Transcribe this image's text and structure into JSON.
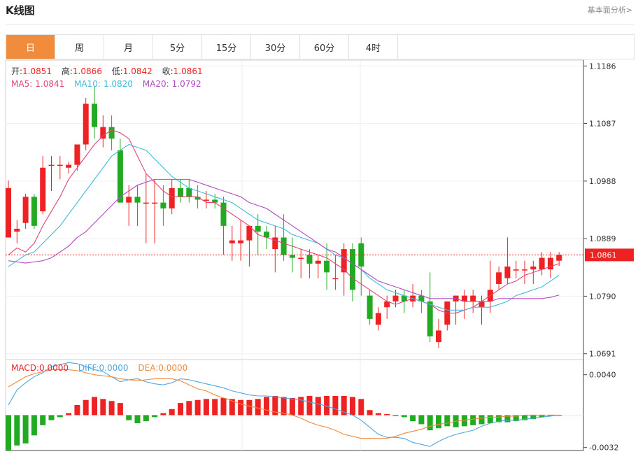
{
  "header": {
    "title": "K线图",
    "link": "基本面分析>"
  },
  "tabs": [
    "日",
    "周",
    "月",
    "5分",
    "15分",
    "30分",
    "60分",
    "4时"
  ],
  "active_tab": 0,
  "ohlc_info": {
    "open_label": "开:",
    "open": "1.0851",
    "high_label": "高:",
    "high": "1.0866",
    "low_label": "低:",
    "low": "1.0842",
    "close_label": "收:",
    "close": "1.0861"
  },
  "ma_info": {
    "ma5_label": "MA5:",
    "ma5": "1.0841",
    "ma10_label": "MA10:",
    "ma10": "1.0820",
    "ma20_label": "MA20:",
    "ma20": "1.0792"
  },
  "macd_info": {
    "macd_label": "MACD:",
    "macd": "0.0000",
    "diff_label": "DIFF:",
    "diff": "0.0000",
    "dea_label": "DEA:",
    "dea": "0.0000"
  },
  "current_price": "1.0861",
  "colors": {
    "up": "#ee2222",
    "down": "#22aa22",
    "ma5": "#e0457a",
    "ma10": "#40bcd8",
    "ma20": "#b04bc0",
    "diff": "#4fa6e0",
    "dea": "#f08a3c",
    "accent": "#f08c3c"
  },
  "chart_data": {
    "type": "candlestick",
    "y_ticks": [
      1.1186,
      1.1087,
      1.0988,
      1.0889,
      1.079,
      1.0691
    ],
    "y_tick_labels": [
      "1.1186",
      "1.1087",
      "1.0988",
      "1.0889",
      "1.0790",
      "1.0691"
    ],
    "ylim": [
      1.0681,
      1.1196
    ],
    "ohlc": [
      [
        1.0891,
        1.0989,
        1.0891,
        1.0976
      ],
      [
        1.0901,
        1.0921,
        1.0881,
        1.0906
      ],
      [
        1.0916,
        1.0966,
        1.0906,
        1.0961
      ],
      [
        1.0961,
        1.0966,
        1.0906,
        1.0911
      ],
      [
        1.0936,
        1.1031,
        1.0931,
        1.1011
      ],
      [
        1.1016,
        1.1031,
        1.0971,
        1.1016
      ],
      [
        1.1016,
        1.1031,
        1.0991,
        1.1016
      ],
      [
        1.1011,
        1.1021,
        1.1001,
        1.1016
      ],
      [
        1.1016,
        1.1051,
        1.1006,
        1.1051
      ],
      [
        1.1051,
        1.1131,
        1.1041,
        1.1121
      ],
      [
        1.1121,
        1.1151,
        1.1061,
        1.1081
      ],
      [
        1.1061,
        1.1101,
        1.1046,
        1.1081
      ],
      [
        1.1081,
        1.1101,
        1.1041,
        1.1061
      ],
      [
        1.1041,
        1.1061,
        1.0971,
        1.0951
      ],
      [
        1.0951,
        1.0981,
        1.0911,
        1.0961
      ],
      [
        1.0961,
        1.0981,
        1.0911,
        1.0951
      ],
      [
        1.0951,
        1.1001,
        1.0881,
        1.0951
      ],
      [
        1.0951,
        1.0991,
        1.0881,
        1.0951
      ],
      [
        1.0951,
        1.0981,
        1.0911,
        1.0941
      ],
      [
        1.0941,
        1.0991,
        1.0931,
        1.0976
      ],
      [
        1.0976,
        1.0991,
        1.0951,
        1.0961
      ],
      [
        1.0976,
        1.0991,
        1.0951,
        1.0961
      ],
      [
        1.0961,
        1.0981,
        1.0941,
        1.0956
      ],
      [
        1.0956,
        1.0971,
        1.0941,
        1.0956
      ],
      [
        1.0956,
        1.0966,
        1.0941,
        1.0951
      ],
      [
        1.0951,
        1.0961,
        1.0861,
        1.0911
      ],
      [
        1.0881,
        1.0911,
        1.0851,
        1.0886
      ],
      [
        1.0881,
        1.0921,
        1.0851,
        1.0886
      ],
      [
        1.0886,
        1.0911,
        1.0841,
        1.0911
      ],
      [
        1.0911,
        1.0931,
        1.0861,
        1.0901
      ],
      [
        1.0901,
        1.0911,
        1.0871,
        1.0891
      ],
      [
        1.0871,
        1.0911,
        1.0831,
        1.0891
      ],
      [
        1.0891,
        1.0931,
        1.0851,
        1.0861
      ],
      [
        1.0861,
        1.0891,
        1.0831,
        1.0856
      ],
      [
        1.0856,
        1.0871,
        1.0821,
        1.0856
      ],
      [
        1.0861,
        1.0871,
        1.0821,
        1.0846
      ],
      [
        1.0846,
        1.0861,
        1.0821,
        1.0851
      ],
      [
        1.0851,
        1.0881,
        1.0801,
        1.0831
      ],
      [
        1.0821,
        1.0861,
        1.0801,
        1.0821
      ],
      [
        1.0831,
        1.0881,
        1.0791,
        1.0871
      ],
      [
        1.0871,
        1.0881,
        1.0781,
        1.0801
      ],
      [
        1.0881,
        1.0891,
        1.0791,
        1.0841
      ],
      [
        1.0791,
        1.0801,
        1.0741,
        1.0751
      ],
      [
        1.0741,
        1.0771,
        1.0731,
        1.0761
      ],
      [
        1.0771,
        1.0791,
        1.0751,
        1.0781
      ],
      [
        1.0781,
        1.0801,
        1.0771,
        1.0791
      ],
      [
        1.0791,
        1.0801,
        1.0761,
        1.0781
      ],
      [
        1.0781,
        1.0811,
        1.0771,
        1.0791
      ],
      [
        1.0791,
        1.0801,
        1.0761,
        1.0781
      ],
      [
        1.0781,
        1.0831,
        1.0711,
        1.0721
      ],
      [
        1.0711,
        1.0751,
        1.0701,
        1.0731
      ],
      [
        1.0741,
        1.0781,
        1.0731,
        1.0781
      ],
      [
        1.0781,
        1.0791,
        1.0741,
        1.0791
      ],
      [
        1.0781,
        1.0801,
        1.0751,
        1.0791
      ],
      [
        1.0781,
        1.0801,
        1.0761,
        1.0791
      ],
      [
        1.0771,
        1.0791,
        1.0741,
        1.0781
      ],
      [
        1.0781,
        1.0851,
        1.0761,
        1.0801
      ],
      [
        1.0811,
        1.0841,
        1.0801,
        1.0831
      ],
      [
        1.0821,
        1.0891,
        1.0811,
        1.0841
      ],
      [
        1.0836,
        1.0851,
        1.0821,
        1.0836
      ],
      [
        1.0836,
        1.0851,
        1.0811,
        1.0836
      ],
      [
        1.0836,
        1.0851,
        1.0811,
        1.0841
      ],
      [
        1.0836,
        1.0866,
        1.0826,
        1.0856
      ],
      [
        1.0836,
        1.0866,
        1.0821,
        1.0856
      ],
      [
        1.0851,
        1.0866,
        1.0842,
        1.0861
      ]
    ],
    "ma5": [
      1.0861,
      1.0873,
      1.0866,
      1.0881,
      1.0911,
      1.0936,
      1.0961,
      1.0991,
      1.1011,
      1.1031,
      1.1051,
      1.1066,
      1.1076,
      1.1071,
      1.1061,
      1.1031,
      1.1001,
      1.0986,
      1.0971,
      1.0961,
      1.0961,
      1.0961,
      1.0961,
      1.0951,
      1.0951,
      1.0941,
      1.0931,
      1.0921,
      1.0911,
      1.0896,
      1.0891,
      1.0886,
      1.0881,
      1.0876,
      1.0871,
      1.0866,
      1.0861,
      1.0856,
      1.0846,
      1.0836,
      1.0821,
      1.0811,
      1.0801,
      1.0791,
      1.0781,
      1.0776,
      1.0781,
      1.0786,
      1.0781,
      1.0776,
      1.0766,
      1.0761,
      1.0761,
      1.0766,
      1.0771,
      1.0781,
      1.0791,
      1.0801,
      1.0811,
      1.0816,
      1.0826,
      1.0831,
      1.0836,
      1.0841,
      1.0846
    ],
    "ma10": [
      1.0841,
      1.0851,
      1.0861,
      1.0866,
      1.0881,
      1.0896,
      1.0911,
      1.0931,
      1.0951,
      1.0971,
      1.0991,
      1.1011,
      1.1031,
      1.1041,
      1.1051,
      1.1046,
      1.1041,
      1.1026,
      1.1011,
      1.0996,
      1.0986,
      1.0976,
      1.0971,
      1.0966,
      1.0961,
      1.0956,
      1.0951,
      1.0941,
      1.0931,
      1.0921,
      1.0916,
      1.0911,
      1.0906,
      1.0896,
      1.0891,
      1.0886,
      1.0881,
      1.0871,
      1.0861,
      1.0856,
      1.0846,
      1.0836,
      1.0821,
      1.0811,
      1.0801,
      1.0796,
      1.0791,
      1.0786,
      1.0781,
      1.0776,
      1.0771,
      1.0766,
      1.0766,
      1.0766,
      1.0771,
      1.0771,
      1.0771,
      1.0776,
      1.0781,
      1.0791,
      1.0796,
      1.0801,
      1.0806,
      1.0816,
      1.0826
    ],
    "ma20": [
      1.0851,
      1.0849,
      1.0847,
      1.0849,
      1.0851,
      1.0856,
      1.0866,
      1.0876,
      1.0891,
      1.0901,
      1.0916,
      1.0931,
      1.0946,
      1.0961,
      1.0971,
      1.0981,
      1.0986,
      1.0991,
      1.0991,
      1.0991,
      1.0991,
      1.0991,
      1.0986,
      1.0981,
      1.0976,
      1.0971,
      1.0966,
      1.0961,
      1.0951,
      1.0946,
      1.0941,
      1.0931,
      1.0921,
      1.0911,
      1.0901,
      1.0891,
      1.0881,
      1.0871,
      1.0866,
      1.0856,
      1.0846,
      1.0836,
      1.0826,
      1.0816,
      1.0811,
      1.0806,
      1.0801,
      1.0796,
      1.0791,
      1.0786,
      1.0786,
      1.0786,
      1.0786,
      1.0781,
      1.0781,
      1.0781,
      1.0781,
      1.0786,
      1.0786,
      1.0786,
      1.0786,
      1.0786,
      1.0786,
      1.0788,
      1.0792
    ],
    "macd_y_ticks": [
      0.004,
      -0.0032
    ],
    "macd_y_tick_labels": [
      "0.0040",
      "-0.0032"
    ],
    "macd_ylim": [
      -0.0035,
      0.0055
    ],
    "macd_hist": [
      -0.0035,
      -0.003,
      -0.0028,
      -0.002,
      -0.001,
      -0.0005,
      -0.0002,
      0.0002,
      0.001,
      0.0015,
      0.0018,
      0.0016,
      0.0014,
      0.0012,
      -0.0005,
      -0.0008,
      -0.0006,
      -0.0002,
      0.0002,
      0.0006,
      0.0012,
      0.0014,
      0.0015,
      0.0016,
      0.0016,
      0.0017,
      0.0016,
      0.0015,
      0.0015,
      0.0016,
      0.0018,
      0.0019,
      0.0018,
      0.0017,
      0.0018,
      0.0019,
      0.0018,
      0.0019,
      0.0019,
      0.0019,
      0.0018,
      0.0016,
      0.0005,
      0.0002,
      0.0001,
      -0.0001,
      -0.0002,
      -0.0006,
      -0.0009,
      -0.0015,
      -0.0013,
      -0.0011,
      -0.0012,
      -0.0011,
      -0.001,
      -0.0009,
      -0.0008,
      -0.0007,
      -0.0007,
      -0.0006,
      -0.0005,
      -0.0004,
      -0.0002,
      -0.0001,
      0
    ],
    "diff": [
      0.001,
      0.0025,
      0.0032,
      0.0038,
      0.0042,
      0.0048,
      0.005,
      0.0052,
      0.0051,
      0.0048,
      0.0045,
      0.0043,
      0.0038,
      0.0033,
      0.0035,
      0.0036,
      0.0033,
      0.0031,
      0.003,
      0.0032,
      0.0036,
      0.0035,
      0.0033,
      0.0031,
      0.0029,
      0.0027,
      0.0024,
      0.0022,
      0.002,
      0.0019,
      0.0019,
      0.0018,
      0.0017,
      0.0016,
      0.0015,
      0.0013,
      0.0011,
      0.0009,
      0.0006,
      0.0003,
      0.0,
      -0.0005,
      -0.0012,
      -0.0019,
      -0.0022,
      -0.0022,
      -0.0023,
      -0.0027,
      -0.0029,
      -0.0031,
      -0.0026,
      -0.0022,
      -0.0019,
      -0.0017,
      -0.0015,
      -0.0011,
      -0.0008,
      -0.0006,
      -0.0005,
      -0.0005,
      -0.0004,
      -0.0003,
      -0.0002,
      -0.0001,
      0
    ],
    "dea": [
      0.0028,
      0.0033,
      0.0038,
      0.0041,
      0.0043,
      0.0045,
      0.0045,
      0.0045,
      0.0044,
      0.0042,
      0.004,
      0.0039,
      0.0038,
      0.0036,
      0.0035,
      0.0034,
      0.0035,
      0.0036,
      0.0036,
      0.0036,
      0.0034,
      0.003,
      0.0026,
      0.0024,
      0.002,
      0.0017,
      0.0014,
      0.0011,
      0.0009,
      0.0007,
      0.0005,
      0.0003,
      0.0002,
      0.0,
      -0.0003,
      -0.0007,
      -0.001,
      -0.0012,
      -0.0015,
      -0.0019,
      -0.0021,
      -0.0023,
      -0.0023,
      -0.0023,
      -0.0023,
      -0.0021,
      -0.0018,
      -0.0016,
      -0.0014,
      -0.0011,
      -0.0009,
      -0.0008,
      -0.0006,
      -0.0005,
      -0.0004,
      -0.0003,
      -0.0002,
      -0.0002,
      -0.0001,
      -0.0001,
      0,
      0,
      0,
      0,
      0
    ]
  }
}
